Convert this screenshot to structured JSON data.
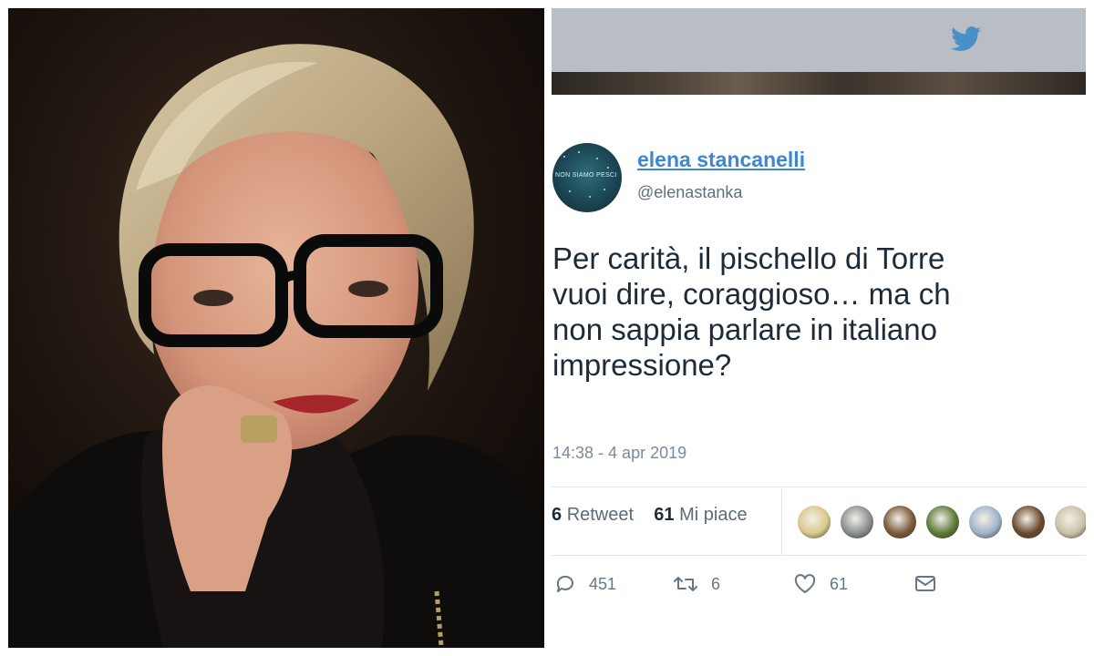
{
  "photo": {
    "alt_subject": "portrait"
  },
  "tweet": {
    "header": {
      "icon": "twitter-bird-icon",
      "bar_color": "#b9bec4",
      "icon_color": "#4a90c8"
    },
    "avatar": {
      "text": "NON SIAMO PESCI"
    },
    "author": {
      "name": "elena stancanelli",
      "handle": "@elenastanka",
      "name_color": "#3d86d6"
    },
    "text_lines": [
      "Per carità, il pischello di Torre",
      "vuoi dire, coraggioso… ma ch",
      "non sappia parlare in italiano",
      "impressione?"
    ],
    "timestamp": "14:38 - 4 apr 2019",
    "stats": {
      "retweets_count": "6",
      "retweets_label": "Retweet",
      "likes_count": "61",
      "likes_label": "Mi piace"
    },
    "likers": [
      {
        "color": "#d9c98a"
      },
      {
        "color": "#8a8f94"
      },
      {
        "color": "#7a5a3a"
      },
      {
        "color": "#5d7a3a"
      },
      {
        "color": "#9fb4c8"
      },
      {
        "color": "#6b4a2e"
      },
      {
        "color": "#c8c2a8"
      }
    ],
    "actions": {
      "reply_count": "451",
      "retweet_count": "6",
      "like_count": "61"
    }
  }
}
